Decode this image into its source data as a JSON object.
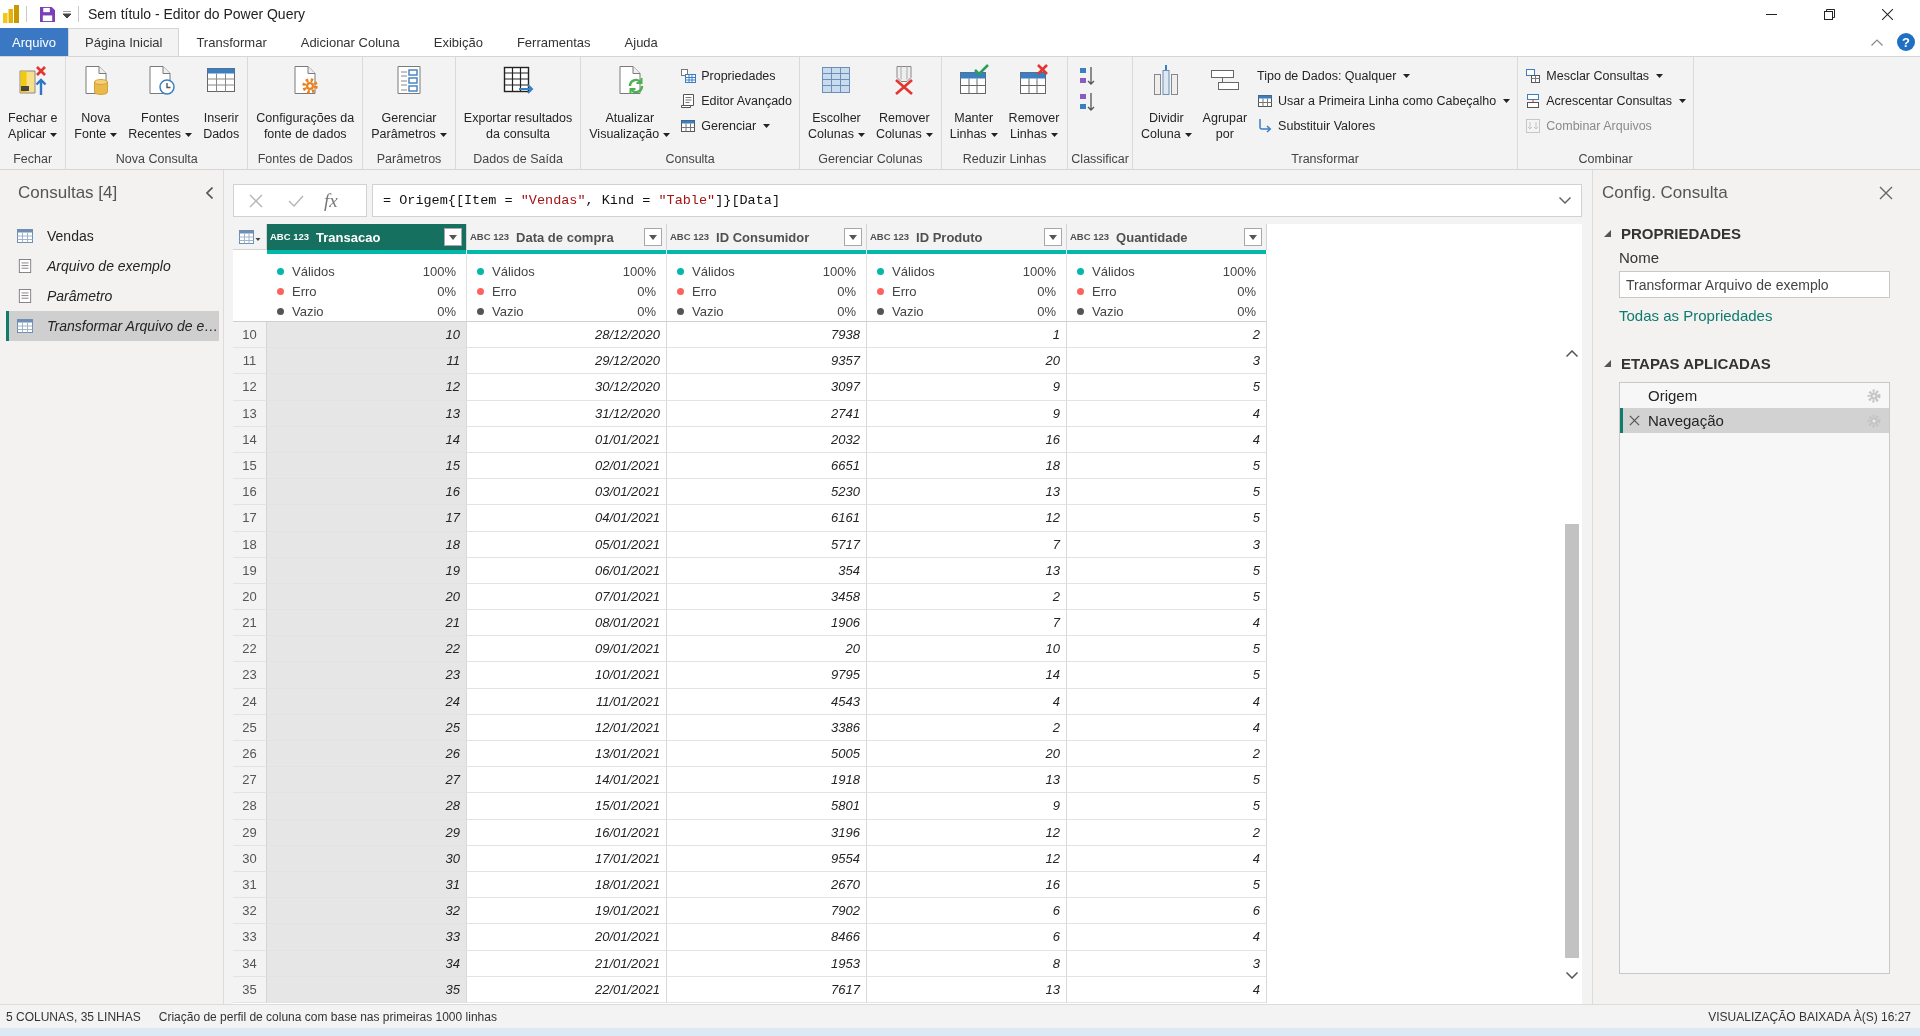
{
  "window": {
    "title": "Sem título - Editor do Power Query"
  },
  "menu_tabs": [
    {
      "label": "Arquivo",
      "kind": "file",
      "selected": false
    },
    {
      "label": "Página Inicial",
      "kind": "tab",
      "selected": true
    },
    {
      "label": "Transformar",
      "kind": "tab",
      "selected": false
    },
    {
      "label": "Adicionar Coluna",
      "kind": "tab",
      "selected": false
    },
    {
      "label": "Exibição",
      "kind": "tab",
      "selected": false
    },
    {
      "label": "Ferramentas",
      "kind": "tab",
      "selected": false
    },
    {
      "label": "Ajuda",
      "kind": "tab",
      "selected": false
    }
  ],
  "help_button": {
    "label": "?"
  },
  "ribbon": {
    "groups": [
      {
        "label": "Fechar",
        "items": [
          {
            "kind": "large",
            "label": "Fechar e\nAplicar",
            "dropdown": true,
            "disabled": false
          }
        ]
      },
      {
        "label": "Nova Consulta",
        "items": [
          {
            "kind": "large",
            "label": "Nova\nFonte",
            "dropdown": true,
            "disabled": false
          },
          {
            "kind": "large",
            "label": "Fontes\nRecentes",
            "dropdown": true,
            "disabled": false
          },
          {
            "kind": "large",
            "label": "Inserir\nDados",
            "dropdown": false,
            "disabled": false
          }
        ]
      },
      {
        "label": "Fontes de Dados",
        "items": [
          {
            "kind": "large",
            "label": "Configurações da\nfonte de dados",
            "dropdown": false,
            "disabled": false
          }
        ]
      },
      {
        "label": "Parâmetros",
        "items": [
          {
            "kind": "large",
            "label": "Gerenciar\nParâmetros",
            "dropdown": true,
            "disabled": false
          }
        ]
      },
      {
        "label": "Dados de Saída",
        "items": [
          {
            "kind": "large",
            "label": "Exportar resultados\nda consulta",
            "dropdown": false,
            "disabled": false
          }
        ]
      },
      {
        "label": "Consulta",
        "items": [
          {
            "kind": "large",
            "label": "Atualizar\nVisualização",
            "dropdown": true,
            "disabled": false
          },
          {
            "kind": "small",
            "label": "Propriedades",
            "dropdown": false,
            "disabled": false
          },
          {
            "kind": "small",
            "label": "Editor Avançado",
            "dropdown": false,
            "disabled": false
          },
          {
            "kind": "small",
            "label": "Gerenciar",
            "dropdown": true,
            "disabled": false
          }
        ]
      },
      {
        "label": "Gerenciar Colunas",
        "items": [
          {
            "kind": "large",
            "label": "Escolher\nColunas",
            "dropdown": true,
            "disabled": false
          },
          {
            "kind": "large",
            "label": "Remover\nColunas",
            "dropdown": true,
            "disabled": false
          }
        ]
      },
      {
        "label": "Reduzir Linhas",
        "items": [
          {
            "kind": "large",
            "label": "Manter\nLinhas",
            "dropdown": true,
            "disabled": false
          },
          {
            "kind": "large",
            "label": "Remover\nLinhas",
            "dropdown": true,
            "disabled": false
          }
        ]
      },
      {
        "label": "Classificar",
        "items": [
          {
            "kind": "icon",
            "disabled": false
          },
          {
            "kind": "icon",
            "disabled": false
          }
        ]
      },
      {
        "label": "Transformar",
        "items": [
          {
            "kind": "large",
            "label": "Dividir\nColuna",
            "dropdown": true,
            "disabled": false
          },
          {
            "kind": "large",
            "label": "Agrupar\npor",
            "dropdown": false,
            "disabled": false
          },
          {
            "kind": "small",
            "label": "Tipo de Dados: Qualquer",
            "dropdown": true,
            "disabled": false
          },
          {
            "kind": "small",
            "label": "Usar a Primeira Linha como Cabeçalho",
            "dropdown": true,
            "disabled": false
          },
          {
            "kind": "small",
            "label": "Substituir Valores",
            "dropdown": false,
            "disabled": false
          }
        ]
      },
      {
        "label": "Combinar",
        "items": [
          {
            "kind": "small",
            "label": "Mesclar Consultas",
            "dropdown": true,
            "disabled": false
          },
          {
            "kind": "small",
            "label": "Acrescentar Consultas",
            "dropdown": true,
            "disabled": false
          },
          {
            "kind": "small",
            "label": "Combinar Arquivos",
            "dropdown": false,
            "disabled": true
          }
        ]
      }
    ]
  },
  "queries_panel": {
    "title": "Consultas [4]",
    "items": [
      {
        "label": "Vendas",
        "kind": "table",
        "load_disabled": false,
        "selected": false
      },
      {
        "label": "Arquivo de exemplo",
        "kind": "document",
        "load_disabled": true,
        "selected": false
      },
      {
        "label": "Parâmetro",
        "kind": "document",
        "load_disabled": true,
        "selected": false
      },
      {
        "label": "Transformar Arquivo de e…",
        "kind": "table",
        "load_disabled": true,
        "selected": true
      }
    ]
  },
  "formula_bar": {
    "fx_label": "fx",
    "tokens": [
      {
        "text": "= Origem{[Item = ",
        "kind": "code"
      },
      {
        "text": "\"Vendas\"",
        "kind": "string"
      },
      {
        "text": ", Kind = ",
        "kind": "code"
      },
      {
        "text": "\"Table\"",
        "kind": "string"
      },
      {
        "text": "]}[Data]",
        "kind": "code"
      }
    ]
  },
  "table": {
    "columns": [
      {
        "name": "Transacao",
        "type_label": "ABC 123",
        "selected": true,
        "quality": {
          "level": 1,
          "stats": [
            {
              "label": "Válidos",
              "value": "100%",
              "color": "#01b8aa"
            },
            {
              "label": "Erro",
              "value": "0%",
              "color": "#fd625e"
            },
            {
              "label": "Vazio",
              "value": "0%",
              "color": "#555555"
            }
          ]
        }
      },
      {
        "name": "Data de compra",
        "type_label": "ABC 123",
        "selected": false,
        "quality": {
          "level": 1,
          "stats": [
            {
              "label": "Válidos",
              "value": "100%",
              "color": "#01b8aa"
            },
            {
              "label": "Erro",
              "value": "0%",
              "color": "#fd625e"
            },
            {
              "label": "Vazio",
              "value": "0%",
              "color": "#555555"
            }
          ]
        }
      },
      {
        "name": "ID Consumidor",
        "type_label": "ABC 123",
        "selected": false,
        "quality": {
          "level": 1,
          "stats": [
            {
              "label": "Válidos",
              "value": "100%",
              "color": "#01b8aa"
            },
            {
              "label": "Erro",
              "value": "0%",
              "color": "#fd625e"
            },
            {
              "label": "Vazio",
              "value": "0%",
              "color": "#555555"
            }
          ]
        }
      },
      {
        "name": "ID Produto",
        "type_label": "ABC 123",
        "selected": false,
        "quality": {
          "level": 1,
          "stats": [
            {
              "label": "Válidos",
              "value": "100%",
              "color": "#01b8aa"
            },
            {
              "label": "Erro",
              "value": "0%",
              "color": "#fd625e"
            },
            {
              "label": "Vazio",
              "value": "0%",
              "color": "#555555"
            }
          ]
        }
      },
      {
        "name": "Quantidade",
        "type_label": "ABC 123",
        "selected": false,
        "quality": {
          "level": 1,
          "stats": [
            {
              "label": "Válidos",
              "value": "100%",
              "color": "#01b8aa"
            },
            {
              "label": "Erro",
              "value": "0%",
              "color": "#fd625e"
            },
            {
              "label": "Vazio",
              "value": "0%",
              "color": "#555555"
            }
          ]
        }
      }
    ],
    "rows": [
      {
        "number": "10",
        "cells": [
          "10",
          "28/12/2020",
          "7938",
          "1",
          "2"
        ]
      },
      {
        "number": "11",
        "cells": [
          "11",
          "29/12/2020",
          "9357",
          "20",
          "3"
        ]
      },
      {
        "number": "12",
        "cells": [
          "12",
          "30/12/2020",
          "3097",
          "9",
          "5"
        ]
      },
      {
        "number": "13",
        "cells": [
          "13",
          "31/12/2020",
          "2741",
          "9",
          "4"
        ]
      },
      {
        "number": "14",
        "cells": [
          "14",
          "01/01/2021",
          "2032",
          "16",
          "4"
        ]
      },
      {
        "number": "15",
        "cells": [
          "15",
          "02/01/2021",
          "6651",
          "18",
          "5"
        ]
      },
      {
        "number": "16",
        "cells": [
          "16",
          "03/01/2021",
          "5230",
          "13",
          "5"
        ]
      },
      {
        "number": "17",
        "cells": [
          "17",
          "04/01/2021",
          "6161",
          "12",
          "5"
        ]
      },
      {
        "number": "18",
        "cells": [
          "18",
          "05/01/2021",
          "5717",
          "7",
          "3"
        ]
      },
      {
        "number": "19",
        "cells": [
          "19",
          "06/01/2021",
          "354",
          "13",
          "5"
        ]
      },
      {
        "number": "20",
        "cells": [
          "20",
          "07/01/2021",
          "3458",
          "2",
          "5"
        ]
      },
      {
        "number": "21",
        "cells": [
          "21",
          "08/01/2021",
          "1906",
          "7",
          "4"
        ]
      },
      {
        "number": "22",
        "cells": [
          "22",
          "09/01/2021",
          "20",
          "10",
          "5"
        ]
      },
      {
        "number": "23",
        "cells": [
          "23",
          "10/01/2021",
          "9795",
          "14",
          "5"
        ]
      },
      {
        "number": "24",
        "cells": [
          "24",
          "11/01/2021",
          "4543",
          "4",
          "4"
        ]
      },
      {
        "number": "25",
        "cells": [
          "25",
          "12/01/2021",
          "3386",
          "2",
          "4"
        ]
      },
      {
        "number": "26",
        "cells": [
          "26",
          "13/01/2021",
          "5005",
          "20",
          "2"
        ]
      },
      {
        "number": "27",
        "cells": [
          "27",
          "14/01/2021",
          "1918",
          "13",
          "5"
        ]
      },
      {
        "number": "28",
        "cells": [
          "28",
          "15/01/2021",
          "5801",
          "9",
          "5"
        ]
      },
      {
        "number": "29",
        "cells": [
          "29",
          "16/01/2021",
          "3196",
          "12",
          "2"
        ]
      },
      {
        "number": "30",
        "cells": [
          "30",
          "17/01/2021",
          "9554",
          "12",
          "4"
        ]
      },
      {
        "number": "31",
        "cells": [
          "31",
          "18/01/2021",
          "2670",
          "16",
          "5"
        ]
      },
      {
        "number": "32",
        "cells": [
          "32",
          "19/01/2021",
          "7902",
          "6",
          "6"
        ]
      },
      {
        "number": "33",
        "cells": [
          "33",
          "20/01/2021",
          "8466",
          "6",
          "4"
        ]
      },
      {
        "number": "34",
        "cells": [
          "34",
          "21/01/2021",
          "1953",
          "8",
          "3"
        ]
      },
      {
        "number": "35",
        "cells": [
          "35",
          "22/01/2021",
          "7617",
          "13",
          "4"
        ]
      }
    ]
  },
  "query_settings": {
    "title": "Config. Consulta",
    "properties": {
      "heading": "PROPRIEDADES",
      "expanded": true,
      "name_label": "Nome",
      "name_value": "Transformar Arquivo de exemplo",
      "link": "Todas as Propriedades"
    },
    "applied_steps": {
      "heading": "ETAPAS APLICADAS",
      "expanded": true,
      "steps": [
        {
          "label": "Origem",
          "selected": false
        },
        {
          "label": "Navegação",
          "selected": true
        }
      ]
    }
  },
  "status_bar": {
    "items": [
      "5 COLUNAS, 35 LINHAS",
      "Criação de perfil de coluna com base nas primeiras 1000 linhas"
    ],
    "right": "VISUALIZAÇÃO BAIXADA À(S) 16:27"
  }
}
